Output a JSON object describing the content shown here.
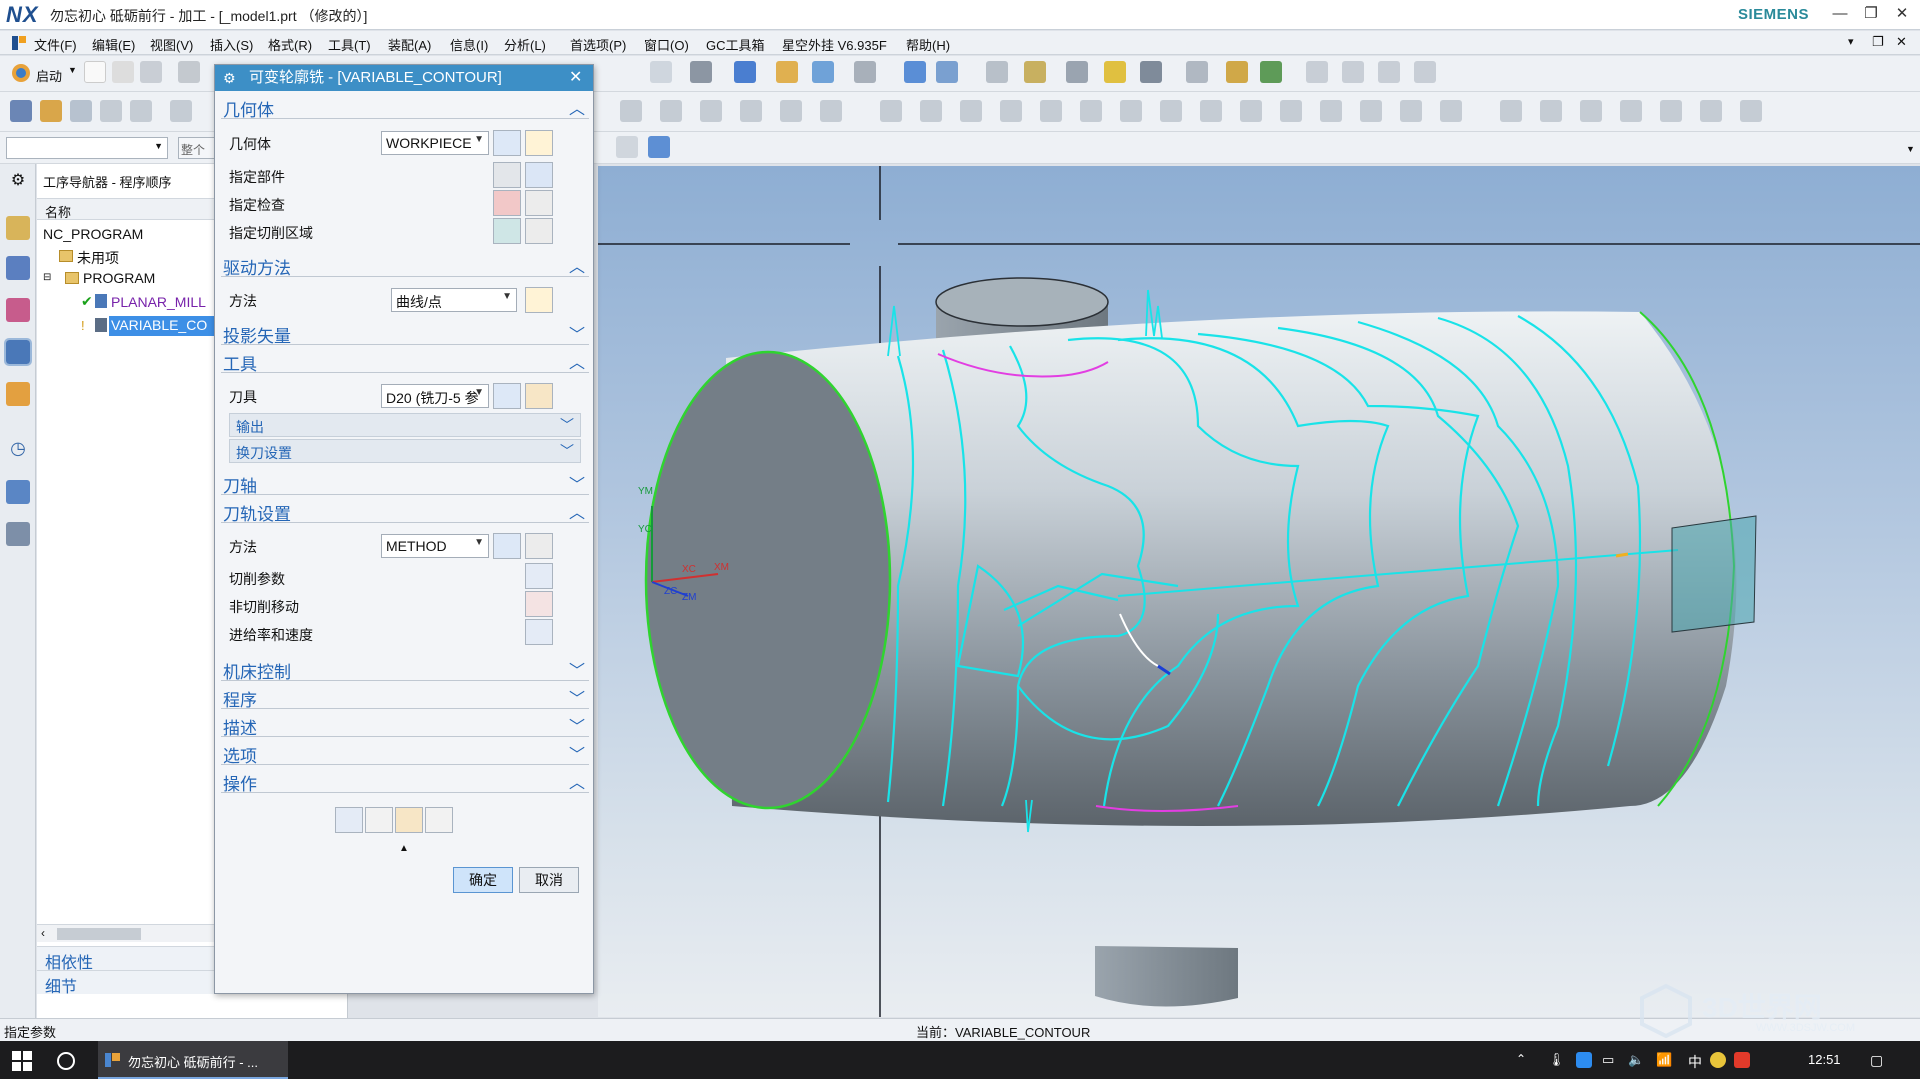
{
  "window": {
    "logo": "NX",
    "title": "勿忘初心 砥砺前行 - 加工 - [_model1.prt （修改的）]",
    "brand": "SIEMENS",
    "controls": [
      "—",
      "❐",
      "✕"
    ]
  },
  "menu": {
    "items": [
      "文件(F)",
      "编辑(E)",
      "视图(V)",
      "插入(S)",
      "格式(R)",
      "工具(T)",
      "装配(A)",
      "信息(I)",
      "分析(L)",
      "首选项(P)",
      "窗口(O)",
      "GC工具箱",
      "星空外挂 V6.935F",
      "帮助(H)"
    ]
  },
  "toolbar": {
    "start_label": "启动",
    "filter_placeholder": "",
    "assembly_filter": "整个"
  },
  "navigator": {
    "title": "工序导航器 - 程序顺序",
    "column_name": "名称",
    "rows": [
      "NC_PROGRAM",
      "未用项",
      "PROGRAM",
      "PLANAR_MILL",
      "VARIABLE_CO"
    ],
    "panel_dependency": "相依性",
    "panel_details": "细节"
  },
  "dialog": {
    "title": "可变轮廓铣 - [VARIABLE_CONTOUR]",
    "geometry": {
      "header": "几何体",
      "geometry_label": "几何体",
      "geometry_value": "WORKPIECE",
      "part_label": "指定部件",
      "check_label": "指定检查",
      "cut_area_label": "指定切削区域"
    },
    "drive": {
      "header": "驱动方法",
      "method_label": "方法",
      "method_value": "曲线/点"
    },
    "projection_header": "投影矢量",
    "tool": {
      "header": "工具",
      "tool_label": "刀具",
      "tool_value": "D20 (铣刀-5 参",
      "output_label": "输出",
      "change_label": "换刀设置"
    },
    "axis_header": "刀轴",
    "path": {
      "header": "刀轨设置",
      "method_label": "方法",
      "method_value": "METHOD",
      "cut_params": "切削参数",
      "non_cut": "非切削移动",
      "feeds": "进给率和速度"
    },
    "machine_header": "机床控制",
    "program_header": "程序",
    "description_header": "描述",
    "options_header": "选项",
    "actions_header": "操作",
    "ok": "确定",
    "cancel": "取消"
  },
  "viewport": {
    "axis_labels": [
      "YM",
      "YC",
      "XC",
      "XM",
      "ZC",
      "ZM"
    ]
  },
  "status": {
    "left": "指定参数",
    "center": "当前：VARIABLE_CONTOUR"
  },
  "taskbar": {
    "app_label": "勿忘初心 砥砺前行 - ...",
    "ime": "中",
    "time": "12:51"
  },
  "watermark": {
    "brand": "3D世界网",
    "url": "WWW.3DSJW.COM"
  },
  "colors": {
    "toolpath": "#19e3e8",
    "edge_green": "#2fd42f",
    "accent": "#3d8fc6",
    "section_text": "#2566b6"
  }
}
